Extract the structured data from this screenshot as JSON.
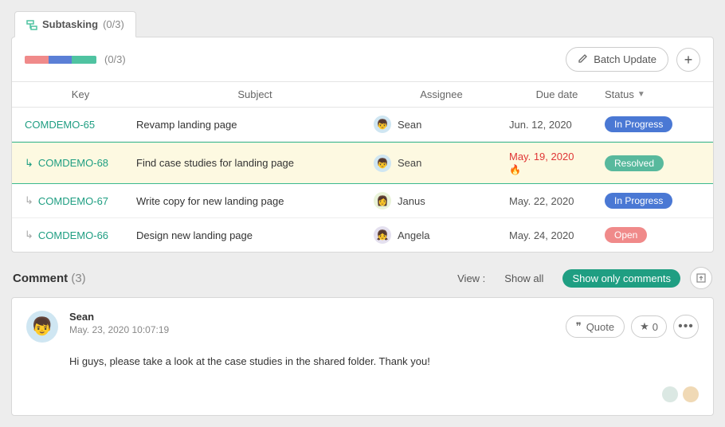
{
  "tab": {
    "label": "Subtasking",
    "count": "(0/3)"
  },
  "progress": {
    "count": "(0/3)",
    "segments": [
      {
        "color": "#f08a8a",
        "pct": 33
      },
      {
        "color": "#5b7fd6",
        "pct": 33
      },
      {
        "color": "#4fc3a1",
        "pct": 34
      }
    ]
  },
  "actions": {
    "batch_update": "Batch Update"
  },
  "columns": {
    "key": "Key",
    "subject": "Subject",
    "assignee": "Assignee",
    "due": "Due date",
    "status": "Status"
  },
  "rows": [
    {
      "key": "COMDEMO-65",
      "child": false,
      "arrow_muted": false,
      "highlight": false,
      "subject": "Revamp landing page",
      "assignee": {
        "name": "Sean",
        "avatar_bg": "#cfe6f2",
        "avatar_char": "👦"
      },
      "due": "Jun. 12, 2020",
      "overdue": false,
      "status": {
        "label": "In Progress",
        "color": "#4a78d4"
      }
    },
    {
      "key": "COMDEMO-68",
      "child": true,
      "arrow_muted": false,
      "highlight": true,
      "subject": "Find case studies for landing page",
      "assignee": {
        "name": "Sean",
        "avatar_bg": "#cfe6f2",
        "avatar_char": "👦"
      },
      "due": "May. 19, 2020",
      "overdue": true,
      "status": {
        "label": "Resolved",
        "color": "#58b99d"
      }
    },
    {
      "key": "COMDEMO-67",
      "child": true,
      "arrow_muted": true,
      "highlight": false,
      "subject": "Write copy for new landing page",
      "assignee": {
        "name": "Janus",
        "avatar_bg": "#e9f3d9",
        "avatar_char": "👩"
      },
      "due": "May. 22, 2020",
      "overdue": false,
      "status": {
        "label": "In Progress",
        "color": "#4a78d4"
      }
    },
    {
      "key": "COMDEMO-66",
      "child": true,
      "arrow_muted": true,
      "highlight": false,
      "subject": "Design new landing page",
      "assignee": {
        "name": "Angela",
        "avatar_bg": "#e4e0ef",
        "avatar_char": "👧"
      },
      "due": "May. 24, 2020",
      "overdue": false,
      "status": {
        "label": "Open",
        "color": "#f08a8a"
      }
    }
  ],
  "comments": {
    "title": "Comment",
    "count": "(3)",
    "view_label": "View :",
    "show_all": "Show all",
    "show_only": "Show only comments",
    "entry": {
      "author": "Sean",
      "time": "May. 23, 2020 10:07:19",
      "body": "Hi guys, please take a look at the case studies in the shared folder. Thank you!",
      "quote_label": "Quote",
      "star_count": "0"
    },
    "mini_avatars": [
      {
        "bg": "#dbe8e3"
      },
      {
        "bg": "#f0d9b5"
      }
    ]
  }
}
